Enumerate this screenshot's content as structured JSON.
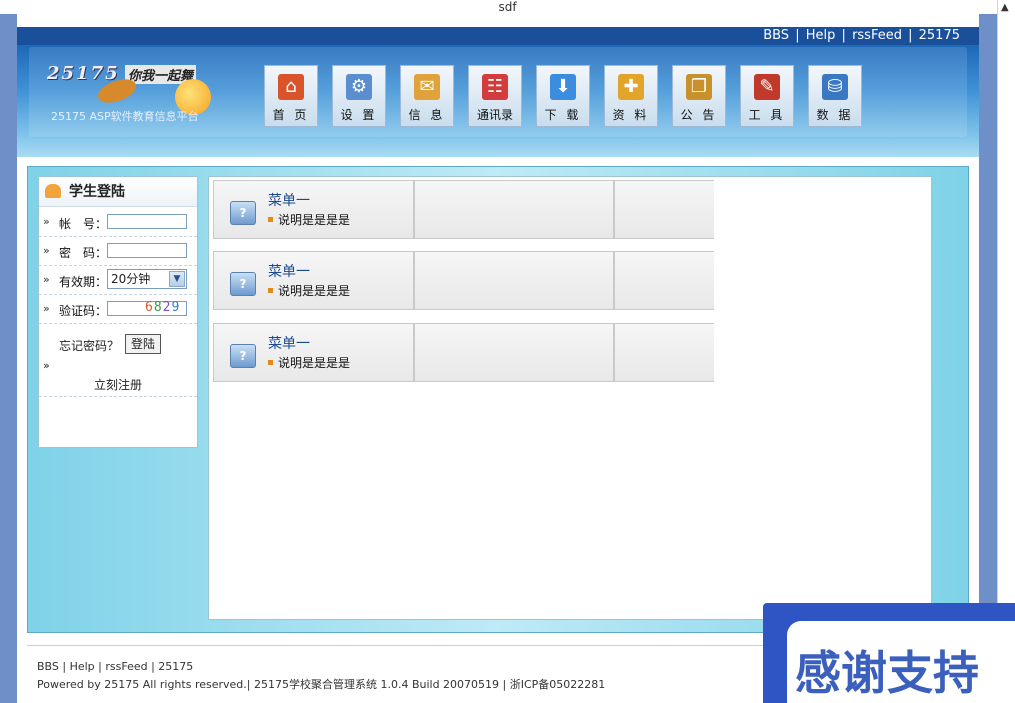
{
  "window": {
    "title": "sdf"
  },
  "topbar": {
    "links": [
      "BBS",
      "Help",
      "rssFeed",
      "25175"
    ],
    "separator": "|"
  },
  "logo": {
    "number": "25175",
    "slogan": "你我一起舞",
    "subtitle": "25175 ASP软件教育信息平台"
  },
  "nav": [
    {
      "label": "首 页",
      "icon": "home-icon",
      "color": "#d9542b"
    },
    {
      "label": "设 置",
      "icon": "settings-icon",
      "color": "#5a8ed0"
    },
    {
      "label": "信 息",
      "icon": "mail-icon",
      "color": "#e0a23a"
    },
    {
      "label": "通讯录",
      "icon": "network-icon",
      "color": "#d23c3c"
    },
    {
      "label": "下 载",
      "icon": "download-icon",
      "color": "#3c8de0"
    },
    {
      "label": "资 料",
      "icon": "document-icon",
      "color": "#e3a42a"
    },
    {
      "label": "公 告",
      "icon": "notice-icon",
      "color": "#c8912c"
    },
    {
      "label": "工 具",
      "icon": "tools-icon",
      "color": "#c0392b"
    },
    {
      "label": "数 据",
      "icon": "database-icon",
      "color": "#3a78c4"
    }
  ],
  "login": {
    "title": "学生登陆",
    "arrow": "»",
    "account_label": "帐　号：",
    "password_label": "密　码：",
    "validity_label": "有效期：",
    "validity_value": "20分钟",
    "captcha_label": "验证码：",
    "captcha_digits": [
      "6",
      "8",
      "2",
      "9"
    ],
    "captcha_colors": [
      "#d9542b",
      "#3b9a44",
      "#7a4fc0",
      "#2a7fd0"
    ],
    "forgot_label": "忘记密码？",
    "login_button": "登陆",
    "register_label": "立刻注册"
  },
  "menus": [
    {
      "title": "菜单一",
      "desc": "说明是是是是"
    },
    {
      "title": "菜单一",
      "desc": "说明是是是是"
    },
    {
      "title": "菜单一",
      "desc": "说明是是是是"
    }
  ],
  "footer": {
    "links": "BBS | Help | rssFeed | 25175",
    "copyright": "Powered by 25175 All rights reserved.| 25175学校聚合管理系统 1.0.4 Build 20070519 | 浙ICP备05022281"
  },
  "overlay": {
    "text": "感谢支持"
  }
}
